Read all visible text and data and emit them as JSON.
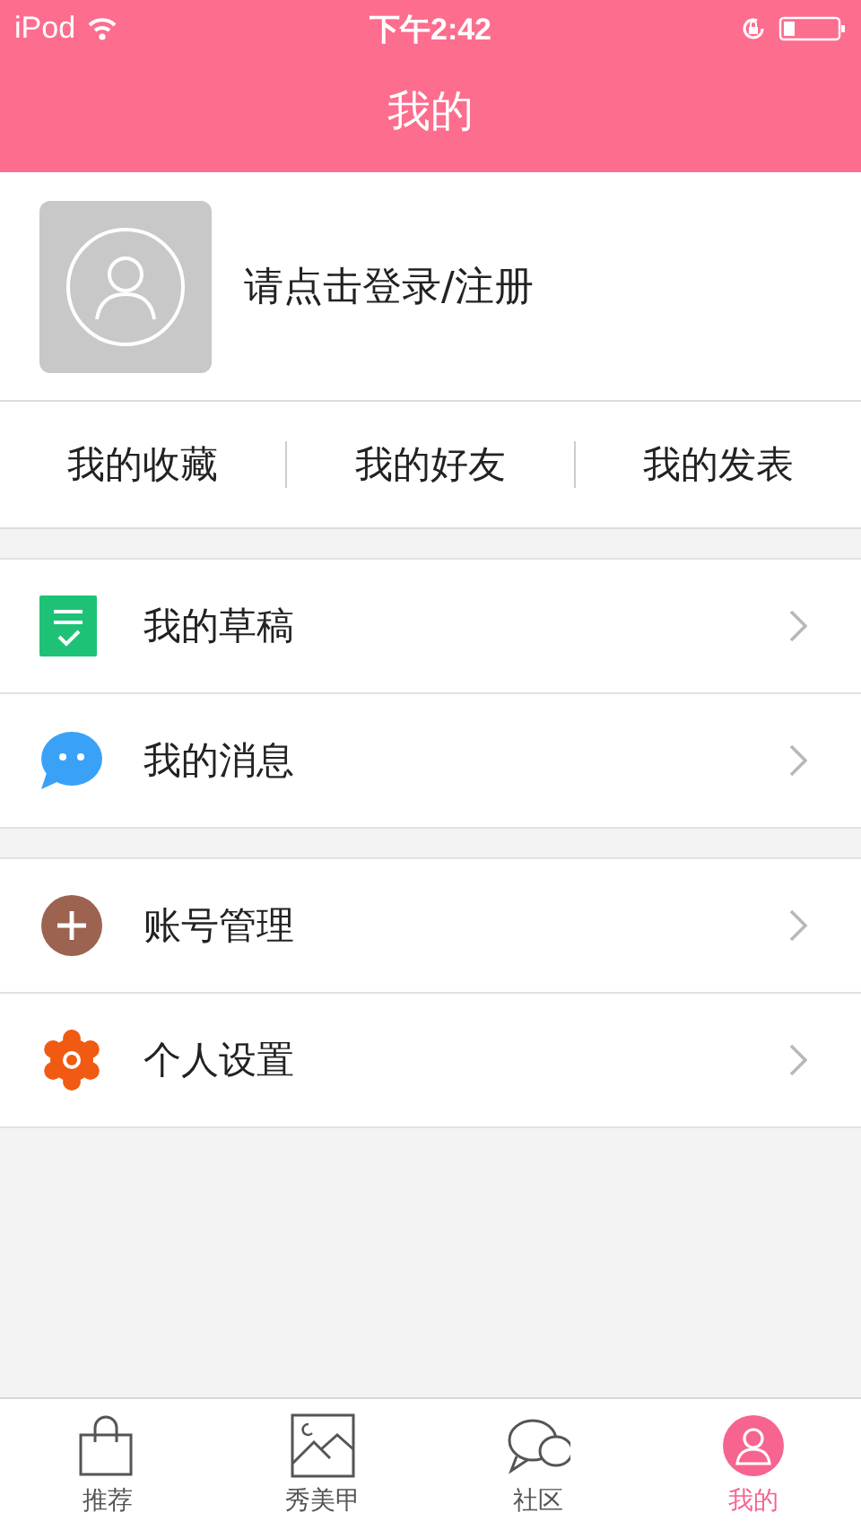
{
  "status_bar": {
    "carrier": "iPod",
    "time": "下午2:42"
  },
  "title": "我的",
  "profile": {
    "login_text": "请点击登录/注册"
  },
  "quick_links": [
    "我的收藏",
    "我的好友",
    "我的发表"
  ],
  "menu_groups": [
    [
      {
        "kind": "draft",
        "label": "我的草稿"
      },
      {
        "kind": "message",
        "label": "我的消息"
      }
    ],
    [
      {
        "kind": "account",
        "label": "账号管理"
      },
      {
        "kind": "settings",
        "label": "个人设置"
      }
    ]
  ],
  "tabs": [
    {
      "kind": "bag",
      "label": "推荐",
      "selected": false
    },
    {
      "kind": "image",
      "label": "秀美甲",
      "selected": false
    },
    {
      "kind": "chat",
      "label": "社区",
      "selected": false
    },
    {
      "kind": "user",
      "label": "我的",
      "selected": true
    }
  ]
}
